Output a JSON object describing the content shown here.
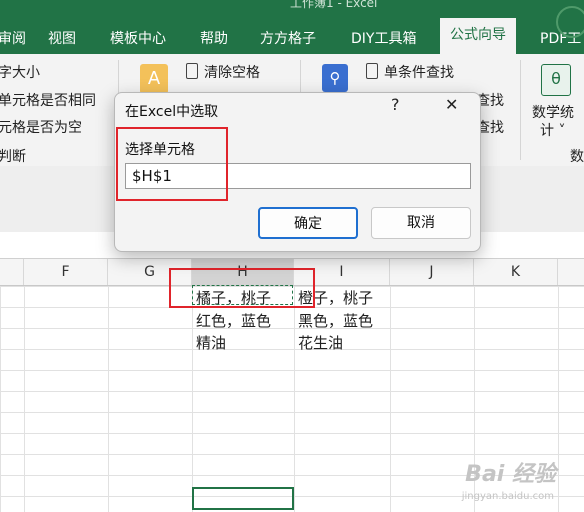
{
  "window": {
    "title_partial": "工作簿1 - Excel"
  },
  "ribbon_tabs": [
    "审阅",
    "视图",
    "模板中心",
    "帮助",
    "方方格子",
    "DIY工具箱",
    "公式向导",
    "PDF工"
  ],
  "active_tab": "公式向导",
  "ribbon": {
    "left_items": [
      "字大小",
      "单元格是否相同",
      "元格是否为空",
      "判断"
    ],
    "mid_items": [
      "清除空格",
      "单条件查找",
      "查找",
      "查找"
    ],
    "right_labels": [
      "数学统",
      "计 ˅",
      "数"
    ]
  },
  "dialog": {
    "title": "在Excel中选取",
    "help": "?",
    "close": "✕",
    "label": "选择单元格",
    "input_value": "$H$1",
    "ok_label": "确定",
    "cancel_label": "取消"
  },
  "columns": [
    "F",
    "G",
    "H",
    "I",
    "J",
    "K"
  ],
  "selected_column": "H",
  "cells": {
    "H1": "橘子，桃子",
    "H2": "红色，蓝色",
    "H3": "精油",
    "I1": "橙子，桃子",
    "I2": "黑色，蓝色",
    "I3": "花生油"
  },
  "watermark": {
    "text": "Bai 经验",
    "sub": "jingyan.baidu.com"
  },
  "colors": {
    "excel_green": "#217346",
    "highlight_red": "#e0242b",
    "button_blue": "#1f6fd0"
  }
}
